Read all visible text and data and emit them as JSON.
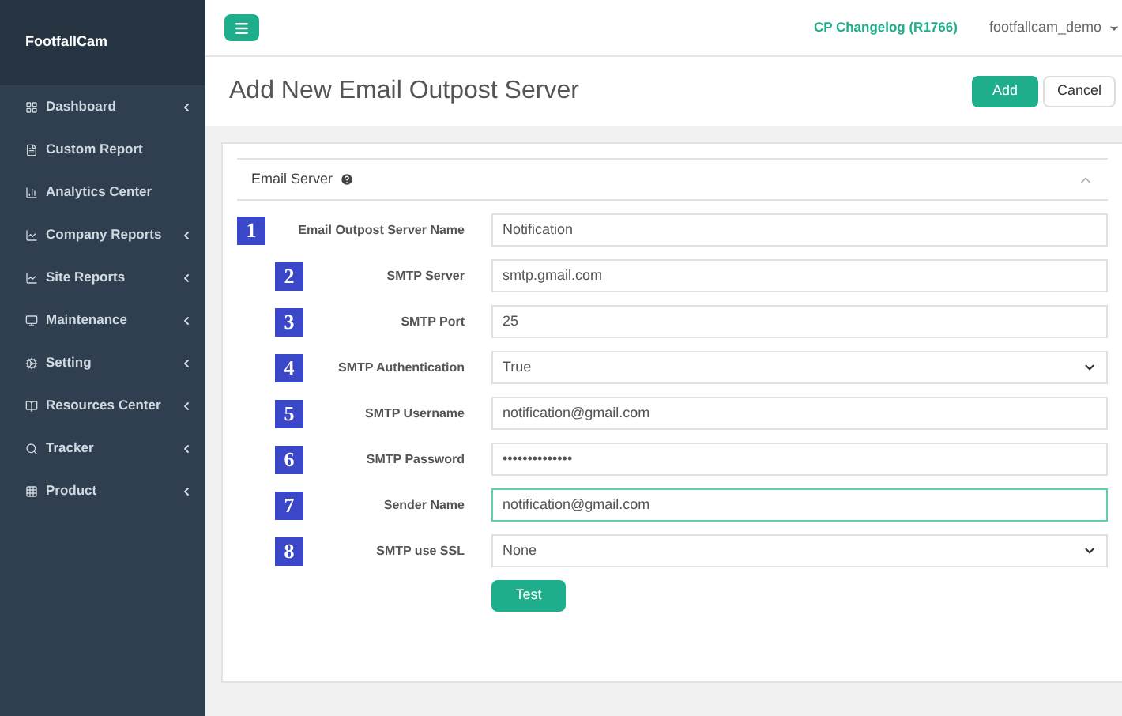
{
  "brand": "FootfallCam",
  "sidebar": {
    "items": [
      {
        "label": "Dashboard",
        "has_submenu": true
      },
      {
        "label": "Custom Report",
        "has_submenu": false
      },
      {
        "label": "Analytics Center",
        "has_submenu": false
      },
      {
        "label": "Company Reports",
        "has_submenu": true
      },
      {
        "label": "Site Reports",
        "has_submenu": true
      },
      {
        "label": "Maintenance",
        "has_submenu": true
      },
      {
        "label": "Setting",
        "has_submenu": true
      },
      {
        "label": "Resources Center",
        "has_submenu": true
      },
      {
        "label": "Tracker",
        "has_submenu": true
      },
      {
        "label": "Product",
        "has_submenu": true
      }
    ]
  },
  "topbar": {
    "changelog": "CP Changelog (R1766)",
    "user": "footfallcam_demo"
  },
  "page_title": "Add New Email Outpost Server",
  "actions": [
    "Add",
    "Cancel"
  ],
  "section": {
    "title": "Email Server",
    "expanded": true
  },
  "form": {
    "fields": [
      {
        "badge": "1",
        "label": "Email Outpost Server Name",
        "kind": "input",
        "value": "Notification",
        "focused": false
      },
      {
        "badge": "2",
        "label": "SMTP Server",
        "kind": "input",
        "value": "smtp.gmail.com",
        "focused": false
      },
      {
        "badge": "3",
        "label": "SMTP Port",
        "kind": "input",
        "value": "25",
        "focused": false
      },
      {
        "badge": "4",
        "label": "SMTP Authentication",
        "kind": "select",
        "value": "True",
        "focused": false
      },
      {
        "badge": "5",
        "label": "SMTP Username",
        "kind": "input",
        "value": "notification@gmail.com",
        "focused": false
      },
      {
        "badge": "6",
        "label": "SMTP Password",
        "kind": "input",
        "value": "••••••••••••••",
        "focused": false
      },
      {
        "badge": "7",
        "label": "Sender Name",
        "kind": "input",
        "value": "notification@gmail.com",
        "focused": true
      },
      {
        "badge": "8",
        "label": "SMTP use SSL",
        "kind": "select",
        "value": "None",
        "focused": false
      }
    ],
    "test_button": "Test"
  }
}
